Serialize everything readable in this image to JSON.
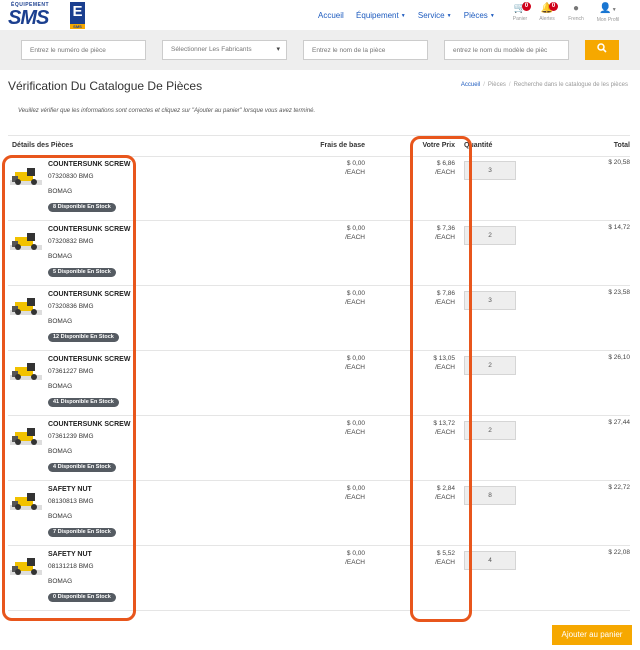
{
  "brand": {
    "logo_top": "ÉQUIPEMENT",
    "logo_main": "SMS",
    "logo_box": "E",
    "logo_sub": "SMS"
  },
  "nav": {
    "links": [
      {
        "label": "Accueil",
        "dropdown": false
      },
      {
        "label": "Équipement",
        "dropdown": true
      },
      {
        "label": "Service",
        "dropdown": true
      },
      {
        "label": "Pièces",
        "dropdown": true
      }
    ],
    "icons": [
      {
        "icon": "cart-icon",
        "label": "Panier",
        "badge": "0"
      },
      {
        "icon": "bell-icon",
        "label": "Alertes",
        "badge": "0"
      },
      {
        "icon": "globe-icon",
        "label": "French",
        "badge": ""
      },
      {
        "icon": "user-icon",
        "label": "Mon Profil",
        "badge": ""
      }
    ]
  },
  "search": {
    "part_number_placeholder": "Entrez le numéro de pièce",
    "manufacturer_select": "Sélectionner Les Fabricants",
    "part_name_placeholder": "Entrez le nom de la pièce",
    "model_placeholder": "entrez le nom du modèle de pièc"
  },
  "page": {
    "title": "Vérification Du Catalogue De Pièces",
    "breadcrumb": [
      "Accueil",
      "Pièces",
      "Recherche dans le catalogue de les pièces"
    ],
    "instructions": "Veuillez vérifier que les informations sont correctes et cliquez sur \"Ajouter au panier\" lorsque vous avez terminé."
  },
  "table": {
    "headers": {
      "details": "Détails des Pièces",
      "base": "Frais de base",
      "price": "Votre Prix",
      "qty": "Quantité",
      "total": "Total"
    },
    "rows": [
      {
        "name": "COUNTERSUNK SCREW",
        "number": "07320830 BMG",
        "brand": "BOMAG",
        "stock": "8 Disponible En Stock",
        "base": "$ 0,00",
        "base_unit": "/EACH",
        "price": "$ 6,86",
        "price_unit": "/EACH",
        "qty": "3",
        "total": "$ 20,58"
      },
      {
        "name": "COUNTERSUNK SCREW",
        "number": "07320832 BMG",
        "brand": "BOMAG",
        "stock": "5 Disponible En Stock",
        "base": "$ 0,00",
        "base_unit": "/EACH",
        "price": "$ 7,36",
        "price_unit": "/EACH",
        "qty": "2",
        "total": "$ 14,72"
      },
      {
        "name": "COUNTERSUNK SCREW",
        "number": "07320836 BMG",
        "brand": "BOMAG",
        "stock": "12 Disponible En Stock",
        "base": "$ 0,00",
        "base_unit": "/EACH",
        "price": "$ 7,86",
        "price_unit": "/EACH",
        "qty": "3",
        "total": "$ 23,58"
      },
      {
        "name": "COUNTERSUNK SCREW",
        "number": "07361227 BMG",
        "brand": "BOMAG",
        "stock": "41 Disponible En Stock",
        "base": "$ 0,00",
        "base_unit": "/EACH",
        "price": "$ 13,05",
        "price_unit": "/EACH",
        "qty": "2",
        "total": "$ 26,10"
      },
      {
        "name": "COUNTERSUNK SCREW",
        "number": "07361239 BMG",
        "brand": "BOMAG",
        "stock": "4 Disponible En Stock",
        "base": "$ 0,00",
        "base_unit": "/EACH",
        "price": "$ 13,72",
        "price_unit": "/EACH",
        "qty": "2",
        "total": "$ 27,44"
      },
      {
        "name": "SAFETY NUT",
        "number": "08130813 BMG",
        "brand": "BOMAG",
        "stock": "7 Disponible En Stock",
        "base": "$ 0,00",
        "base_unit": "/EACH",
        "price": "$ 2,84",
        "price_unit": "/EACH",
        "qty": "8",
        "total": "$ 22,72"
      },
      {
        "name": "SAFETY NUT",
        "number": "08131218 BMG",
        "brand": "BOMAG",
        "stock": "0 Disponible En Stock",
        "base": "$ 0,00",
        "base_unit": "/EACH",
        "price": "$ 5,52",
        "price_unit": "/EACH",
        "qty": "4",
        "total": "$ 22,08"
      }
    ]
  },
  "actions": {
    "add_to_cart": "Ajouter au panier"
  },
  "colors": {
    "brand_blue": "#1b3f8f",
    "accent_orange": "#f6a800",
    "highlight": "#e8561c",
    "badge_red": "#d0021b"
  }
}
